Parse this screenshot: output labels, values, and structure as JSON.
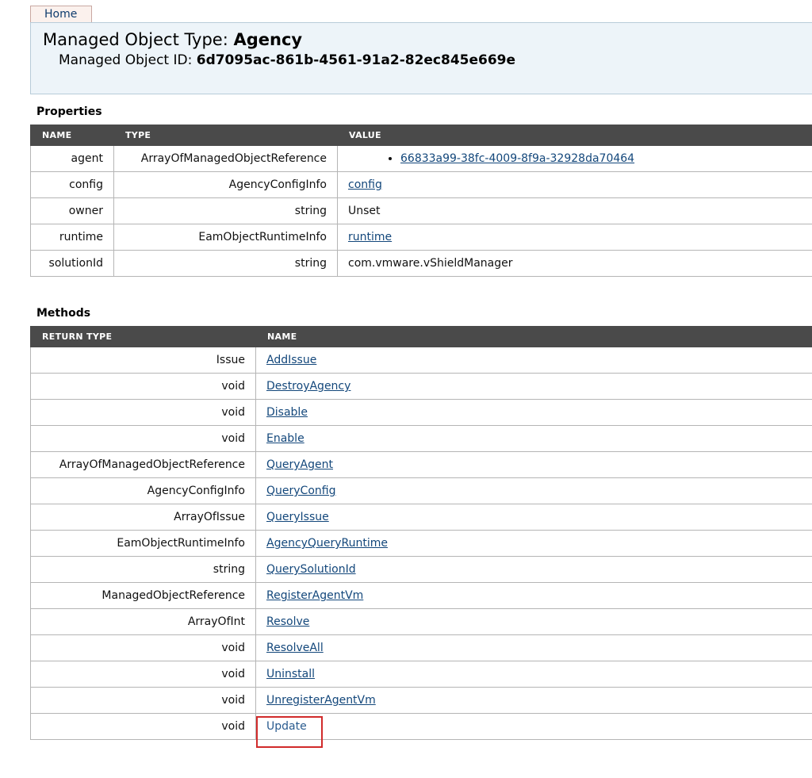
{
  "nav": {
    "home_label": "Home"
  },
  "header": {
    "type_label": "Managed Object Type: ",
    "type_value": "Agency",
    "id_label": "Managed Object ID: ",
    "id_value": "6d7095ac-861b-4561-91a2-82ec845e669e"
  },
  "properties": {
    "title": "Properties",
    "columns": [
      "NAME",
      "TYPE",
      "VALUE"
    ],
    "rows": [
      {
        "name": "agent",
        "type": "ArrayOfManagedObjectReference",
        "value": "66833a99-38fc-4009-8f9a-32928da70464",
        "value_kind": "list-link"
      },
      {
        "name": "config",
        "type": "AgencyConfigInfo",
        "value": "config",
        "value_kind": "link"
      },
      {
        "name": "owner",
        "type": "string",
        "value": "Unset",
        "value_kind": "text"
      },
      {
        "name": "runtime",
        "type": "EamObjectRuntimeInfo",
        "value": "runtime",
        "value_kind": "link"
      },
      {
        "name": "solutionId",
        "type": "string",
        "value": "com.vmware.vShieldManager",
        "value_kind": "text"
      }
    ]
  },
  "methods": {
    "title": "Methods",
    "columns": [
      "RETURN TYPE",
      "NAME"
    ],
    "rows": [
      {
        "return_type": "Issue",
        "name": "AddIssue"
      },
      {
        "return_type": "void",
        "name": "DestroyAgency"
      },
      {
        "return_type": "void",
        "name": "Disable"
      },
      {
        "return_type": "void",
        "name": "Enable"
      },
      {
        "return_type": "ArrayOfManagedObjectReference",
        "name": "QueryAgent"
      },
      {
        "return_type": "AgencyConfigInfo",
        "name": "QueryConfig"
      },
      {
        "return_type": "ArrayOfIssue",
        "name": "QueryIssue"
      },
      {
        "return_type": "EamObjectRuntimeInfo",
        "name": "AgencyQueryRuntime"
      },
      {
        "return_type": "string",
        "name": "QuerySolutionId"
      },
      {
        "return_type": "ManagedObjectReference",
        "name": "RegisterAgentVm"
      },
      {
        "return_type": "ArrayOfInt",
        "name": "Resolve"
      },
      {
        "return_type": "void",
        "name": "ResolveAll"
      },
      {
        "return_type": "void",
        "name": "Uninstall"
      },
      {
        "return_type": "void",
        "name": "UnregisterAgentVm"
      },
      {
        "return_type": "void",
        "name": "Update",
        "highlighted": true
      }
    ]
  },
  "colors": {
    "header_bg": "#edf4f9",
    "table_header_bg": "#4a4a4a",
    "link": "#13477b",
    "highlight": "#d12b2b"
  }
}
